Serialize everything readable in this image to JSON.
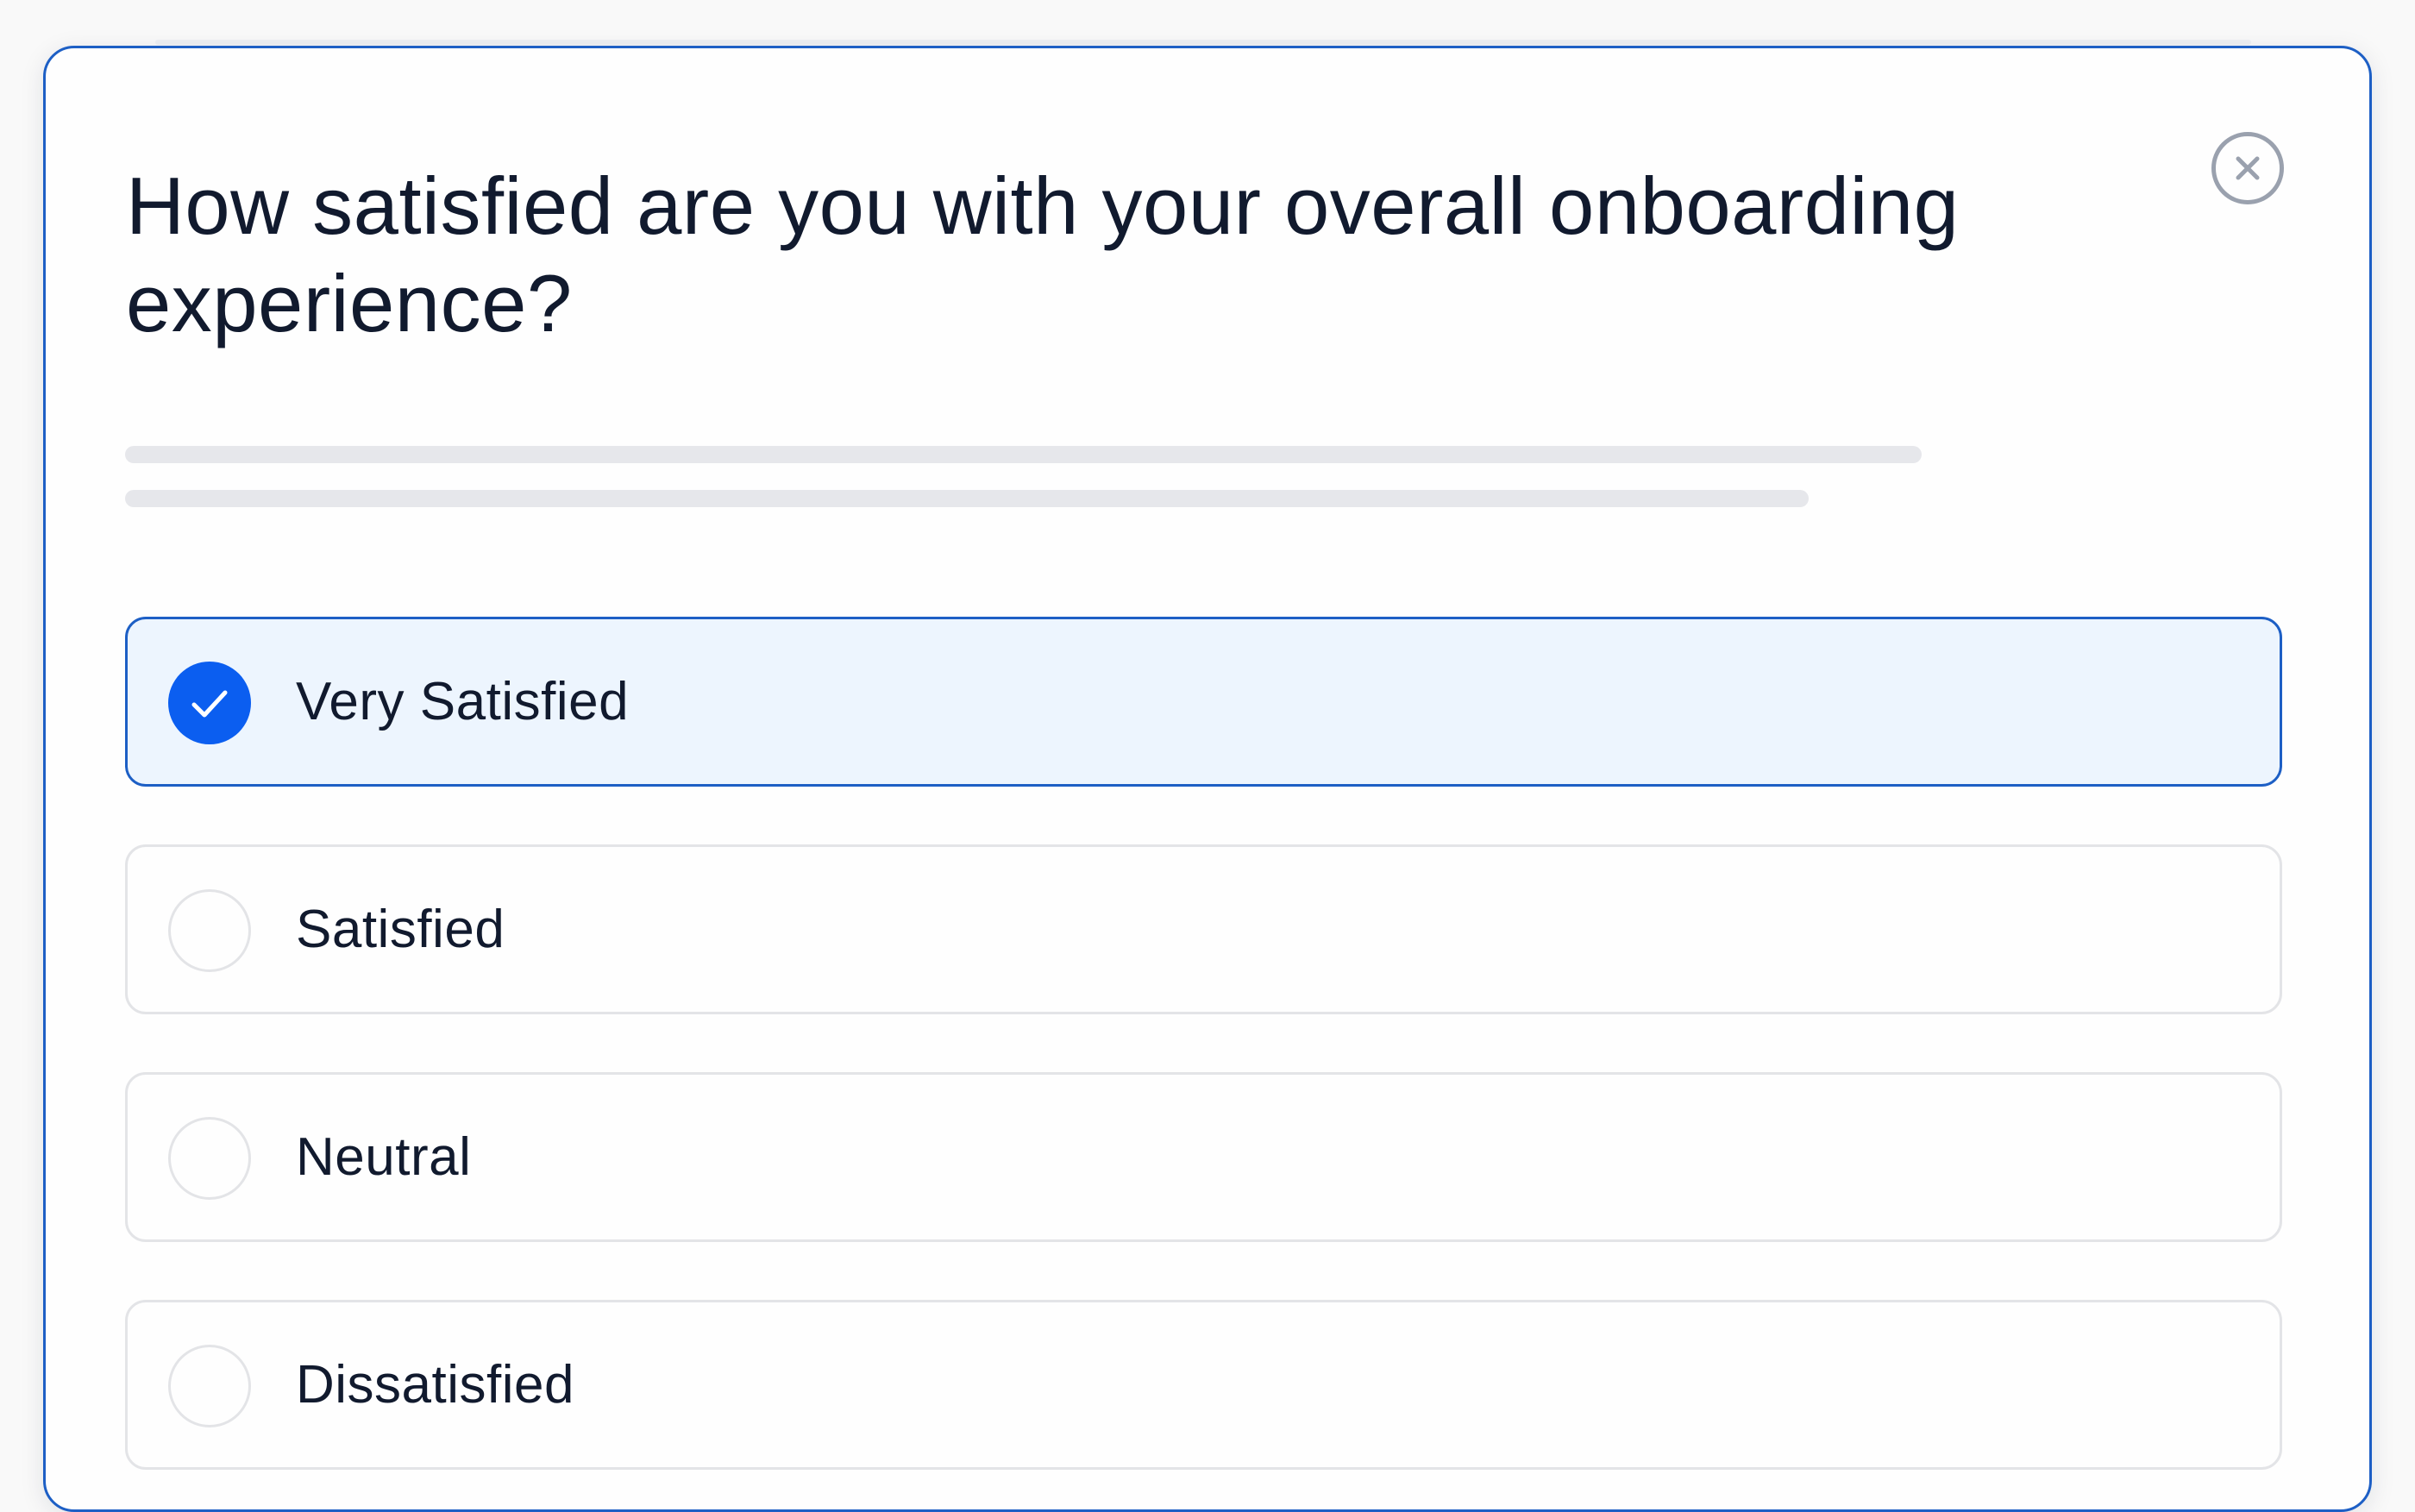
{
  "dialog": {
    "question": "How satisfied are you with your overall onboarding experience?",
    "close_icon": "close-icon"
  },
  "options": [
    {
      "label": "Very Satisfied",
      "selected": true
    },
    {
      "label": "Satisfied",
      "selected": false
    },
    {
      "label": "Neutral",
      "selected": false
    },
    {
      "label": "Dissatisfied",
      "selected": false
    }
  ],
  "colors": {
    "accent": "#0b5ef0",
    "border_accent": "#1d5fc5",
    "selected_background": "#edf5fe",
    "text": "#111a2e",
    "neutral_border": "#e3e4e7"
  }
}
